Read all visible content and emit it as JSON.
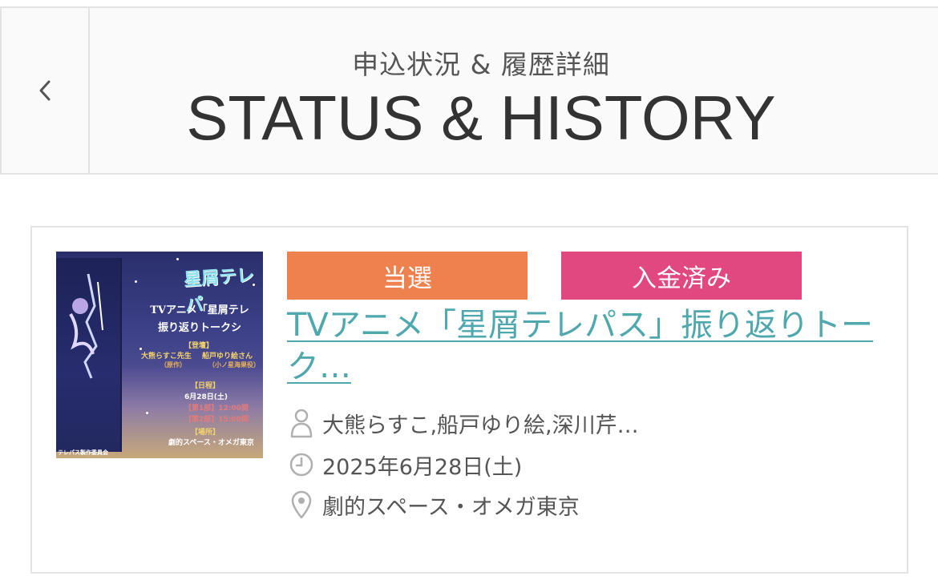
{
  "header": {
    "subtitle": "申込状況 & 履歴詳細",
    "title": "STATUS & HISTORY",
    "back_icon": "chevron-left-icon"
  },
  "event": {
    "badges": [
      {
        "label": "当選",
        "color": "#ef814f"
      },
      {
        "label": "入金済み",
        "color": "#e0487f"
      }
    ],
    "title": "TVアニメ「星屑テレパス」振り返りトーク…",
    "performers": "大熊らすこ,船戸ゆり絵,深川芹…",
    "date": "2025年6月28日(土)",
    "venue": "劇的スペース・オメガ東京",
    "icons": {
      "performers": "person-icon",
      "date": "clock-icon",
      "venue": "location-pin-icon"
    },
    "thumbnail": {
      "logo": "星屑テレパ",
      "line1": "TVアニメ「星屑テレ",
      "line2": "振り返りトークシ",
      "cast_heading": "【登壇】",
      "cast1": "大熊らすこ先生",
      "cast2": "船戸ゆり絵さん",
      "cast1_role": "（原作）",
      "cast2_role": "（小ノ星海果役）",
      "date_heading": "【日程】",
      "date": "6月28日(土)",
      "part1": "【第1部】12:00開",
      "part2": "【第2部】15:00開",
      "venue_heading": "【場所】",
      "venue": "劇的スペース・オメガ東京",
      "footer": "テレパス製作委員会"
    }
  },
  "colors": {
    "link": "#4fa8ae",
    "border": "#e3e3e3",
    "badge_won": "#ef814f",
    "badge_paid": "#e0487f"
  }
}
